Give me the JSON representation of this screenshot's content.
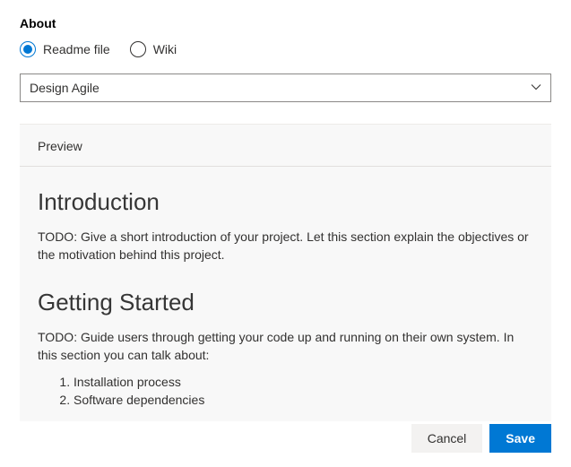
{
  "heading": "About",
  "radios": {
    "readme": "Readme file",
    "wiki": "Wiki",
    "selected": "readme"
  },
  "dropdown": {
    "selected": "Design Agile"
  },
  "preview": {
    "tab": "Preview",
    "intro_heading": "Introduction",
    "intro_body": "TODO: Give a short introduction of your project. Let this section explain the objectives or the motivation behind this project.",
    "getting_started_heading": "Getting Started",
    "getting_started_body": "TODO: Guide users through getting your code up and running on their own system. In this section you can talk about:",
    "bullets": {
      "b1": "Installation process",
      "b2": "Software dependencies"
    }
  },
  "footer": {
    "cancel": "Cancel",
    "save": "Save"
  }
}
